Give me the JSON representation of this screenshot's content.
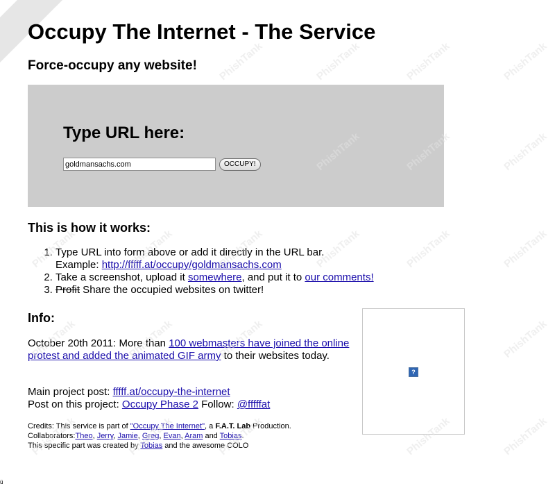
{
  "header": {
    "title": "Occupy The Internet - The Service",
    "subtitle": "Force-occupy any website!"
  },
  "url_form": {
    "heading": "Type URL here:",
    "input_value": "goldmansachs.com",
    "button_label": "OCCUPY!"
  },
  "how": {
    "title": "This is how it works:",
    "step1_text": "Type URL into form above or add it directly in the URL bar.",
    "step1_example_label": "Example: ",
    "step1_example_link": "http://fffff.at/occupy/goldmansachs.com",
    "step2_prefix": "Take a screenshot, upload it ",
    "step2_link1": "somewhere",
    "step2_mid": ", and put it to ",
    "step2_link2": "our comments!",
    "step3_struck": "Profit",
    "step3_text": " Share the occupied websites on twitter!"
  },
  "info": {
    "title": "Info:",
    "date_prefix": "October 20th 2011: More than ",
    "date_link": "100 webmasters have joined the online protest and added the animated GIF army",
    "date_suffix": " to their websites today.",
    "main_post_label": "Main project post: ",
    "main_post_link": "fffff.at/occupy-the-internet",
    "post_label": "Post on this project: ",
    "post_link": "Occupy Phase 2",
    "follow_label": " Follow: ",
    "follow_link": "@fffffat"
  },
  "credits": {
    "line1_prefix": "Credits: This service is part of ",
    "line1_link": "\"Occupy The Internet\"",
    "line1_mid": ", a ",
    "line1_bold": "F.A.T. Lab",
    "line1_suffix": " Production.",
    "collab_label": "Collaborators:",
    "collaborators": [
      "Theo",
      "Jerry",
      "Jamie",
      "Greg",
      "Evan",
      "Aram",
      "Tobias"
    ],
    "sep": ", ",
    "and": " and ",
    "end": ".",
    "line3_prefix": "This specific part was created by ",
    "line3_link": "Tobias",
    "line3_suffix": " and the awesome COLO"
  },
  "image_frame": {
    "placeholder": "?"
  },
  "watermark": {
    "text": "PhishTank"
  },
  "corner_mark": "ü",
  "colors": {
    "link": "#1a0dab",
    "box_bg": "#cccccc"
  }
}
